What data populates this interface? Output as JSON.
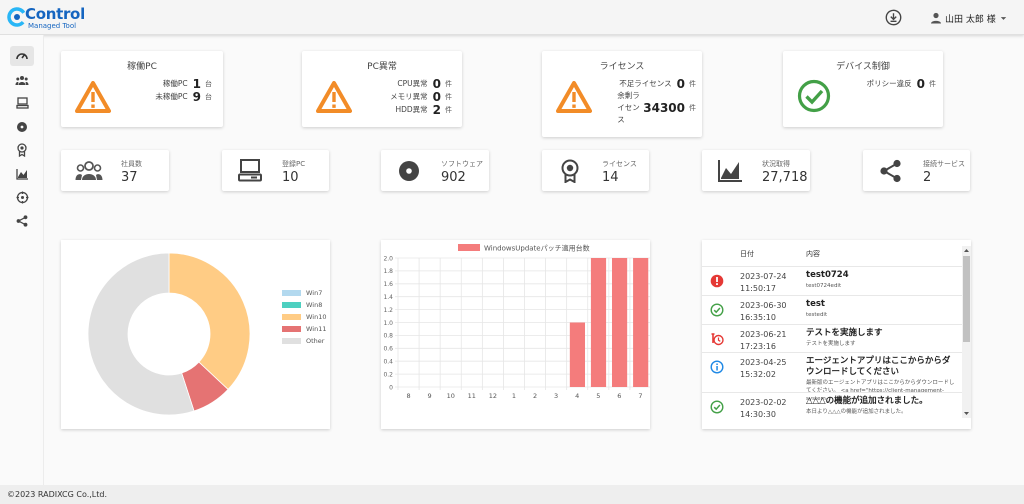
{
  "header": {
    "logo_text": "Control",
    "logo_sub": "Managed Tool",
    "user_name": "山田 太郎 様"
  },
  "sidebar": {
    "items": [
      "dashboard-icon",
      "users-icon",
      "pc-icon",
      "disc-icon",
      "license-icon",
      "chart-icon",
      "network-icon",
      "share-icon"
    ]
  },
  "status_cards": [
    {
      "title": "稼働PC",
      "rows": [
        {
          "label": "稼働PC",
          "value": "1",
          "unit": "台"
        },
        {
          "label": "未稼働PC",
          "value": "9",
          "unit": "台"
        }
      ]
    },
    {
      "title": "PC異常",
      "rows": [
        {
          "label": "CPU異常",
          "value": "0",
          "unit": "件"
        },
        {
          "label": "メモリ異常",
          "value": "0",
          "unit": "件"
        },
        {
          "label": "HDD異常",
          "value": "2",
          "unit": "件"
        }
      ]
    },
    {
      "title": "ライセンス",
      "rows": [
        {
          "label": "不足ライセンス",
          "value": "0",
          "unit": "件"
        },
        {
          "label": "余剰ラ\nイセン\nス",
          "value": "34300",
          "unit": "件"
        }
      ]
    },
    {
      "title": "デバイス制御",
      "rows": [
        {
          "label": "ポリシー違反",
          "value": "0",
          "unit": "件"
        }
      ]
    }
  ],
  "summary_cards": [
    {
      "label": "社員数",
      "value": "37"
    },
    {
      "label": "登録PC",
      "value": "10"
    },
    {
      "label": "ソフトウェア",
      "value": "902"
    },
    {
      "label": "ライセンス",
      "value": "14"
    },
    {
      "label": "状況取得",
      "value": "27,718"
    },
    {
      "label": "接続サービス",
      "value": "2"
    }
  ],
  "chart_data": [
    {
      "type": "pie",
      "categories": [
        "Win7",
        "Win8",
        "Win10",
        "Win11",
        "Other"
      ],
      "values": [
        0,
        0,
        37,
        8,
        55
      ],
      "colors": [
        "#b3d9ef",
        "#4dd0c0",
        "#ffcc85",
        "#e57373",
        "#e0e0e0"
      ],
      "legend": "right"
    },
    {
      "type": "bar",
      "series": [
        {
          "name": "WindowsUpdateパッチ適用台数",
          "values": [
            0,
            0,
            0,
            0,
            0,
            0,
            0,
            0,
            1,
            2,
            2,
            2
          ]
        }
      ],
      "categories": [
        "8",
        "9",
        "10",
        "11",
        "12",
        "1",
        "2",
        "3",
        "4",
        "5",
        "6",
        "7"
      ],
      "ylim": [
        0,
        2
      ],
      "yticks": [
        "0",
        "0.2",
        "0.4",
        "0.6",
        "0.8",
        "1.0",
        "1.2",
        "1.4",
        "1.6",
        "1.8",
        "2.0"
      ],
      "color": "#f47c7c",
      "grid": true,
      "legend": "top"
    }
  ],
  "log": {
    "col_date": "日付",
    "col_content": "内容",
    "rows": [
      {
        "icon": "error-icon",
        "color": "#e53935",
        "date": "2023-07-24",
        "time": "11:50:17",
        "title": "test0724",
        "desc": "test0724edit"
      },
      {
        "icon": "check-circle-icon",
        "color": "#43a047",
        "date": "2023-06-30",
        "time": "16:35:10",
        "title": "test",
        "desc": "testedit"
      },
      {
        "icon": "alarm-icon",
        "color": "#e53935",
        "date": "2023-06-21",
        "time": "17:23:16",
        "title": "テストを実施します",
        "desc": "テストを実施します"
      },
      {
        "icon": "info-icon",
        "color": "#1e88e5",
        "date": "2023-04-25",
        "time": "15:32:02",
        "title": "エージェントアプリはここからからダウンロードしてください",
        "desc": "最新版のエージェントアプリはここからからダウンロードしてください。 <a href=\"https://client-management-system-"
      },
      {
        "icon": "check-circle-icon",
        "color": "#43a047",
        "date": "2023-02-02",
        "time": "14:30:30",
        "title": "△△△の機能が追加されました。",
        "desc": "本日より△△△の機能が追加されました。"
      }
    ]
  },
  "footer": {
    "text": "©2023 RADIXCG Co.,Ltd."
  }
}
